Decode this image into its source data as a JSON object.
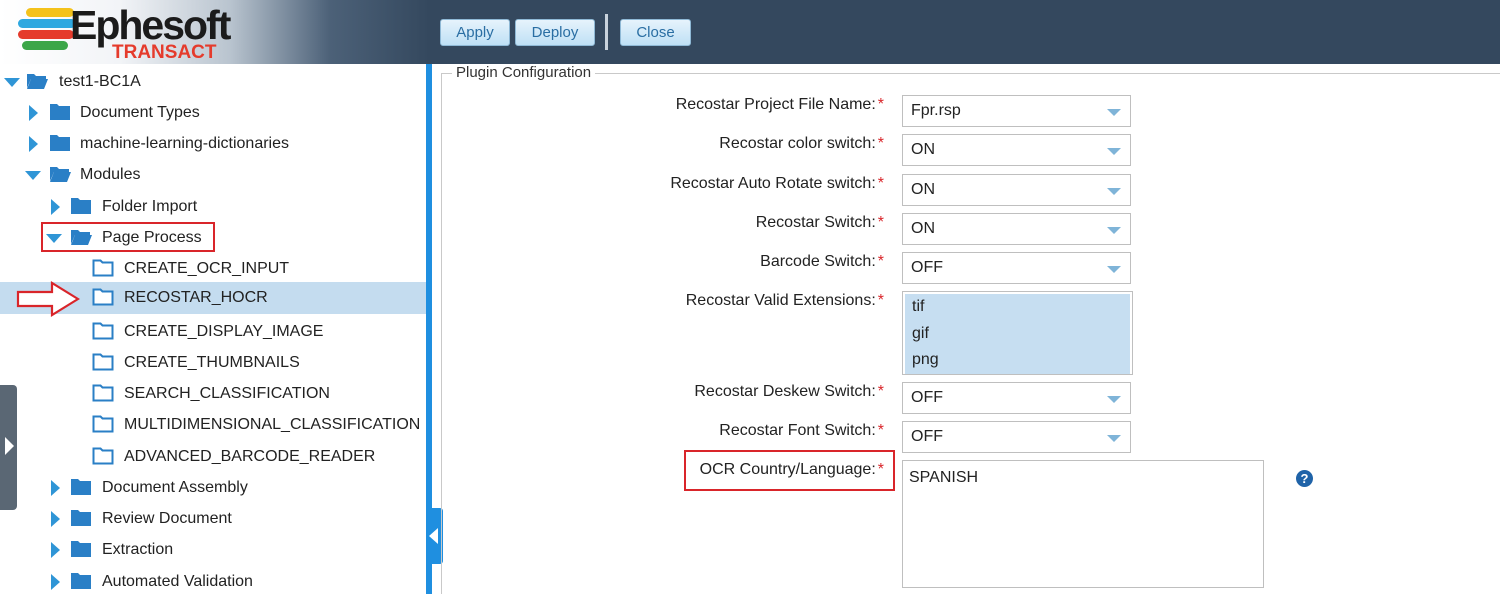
{
  "header": {
    "logo_name": "Ephesoft",
    "logo_sub": "TRANSACT",
    "buttons": {
      "apply": "Apply",
      "deploy": "Deploy",
      "close": "Close"
    }
  },
  "tree": {
    "root": "test1-BC1A",
    "document_types": "Document Types",
    "ml_dictionaries": "machine-learning-dictionaries",
    "modules": "Modules",
    "folder_import": "Folder Import",
    "page_process": "Page Process",
    "plugins": [
      "CREATE_OCR_INPUT",
      "RECOSTAR_HOCR",
      "CREATE_DISPLAY_IMAGE",
      "CREATE_THUMBNAILS",
      "SEARCH_CLASSIFICATION",
      "MULTIDIMENSIONAL_CLASSIFICATION",
      "ADVANCED_BARCODE_READER"
    ],
    "modules_after": [
      "Document Assembly",
      "Review Document",
      "Extraction",
      "Automated Validation"
    ]
  },
  "config": {
    "legend": "Plugin Configuration",
    "required_mark": "*",
    "fields": {
      "project_file": {
        "label": "Recostar Project File Name:",
        "value": "Fpr.rsp"
      },
      "color_switch": {
        "label": "Recostar color switch:",
        "value": "ON"
      },
      "auto_rotate": {
        "label": "Recostar Auto Rotate switch:",
        "value": "ON"
      },
      "recostar_switch": {
        "label": "Recostar Switch:",
        "value": "ON"
      },
      "barcode_switch": {
        "label": "Barcode Switch:",
        "value": "OFF"
      },
      "valid_extensions": {
        "label": "Recostar Valid Extensions:",
        "values": [
          "tif",
          "gif",
          "png"
        ]
      },
      "deskew_switch": {
        "label": "Recostar Deskew Switch:",
        "value": "OFF"
      },
      "font_switch": {
        "label": "Recostar Font Switch:",
        "value": "OFF"
      },
      "ocr_language": {
        "label": "OCR Country/Language:",
        "value": "SPANISH"
      }
    },
    "help_glyph": "?"
  }
}
